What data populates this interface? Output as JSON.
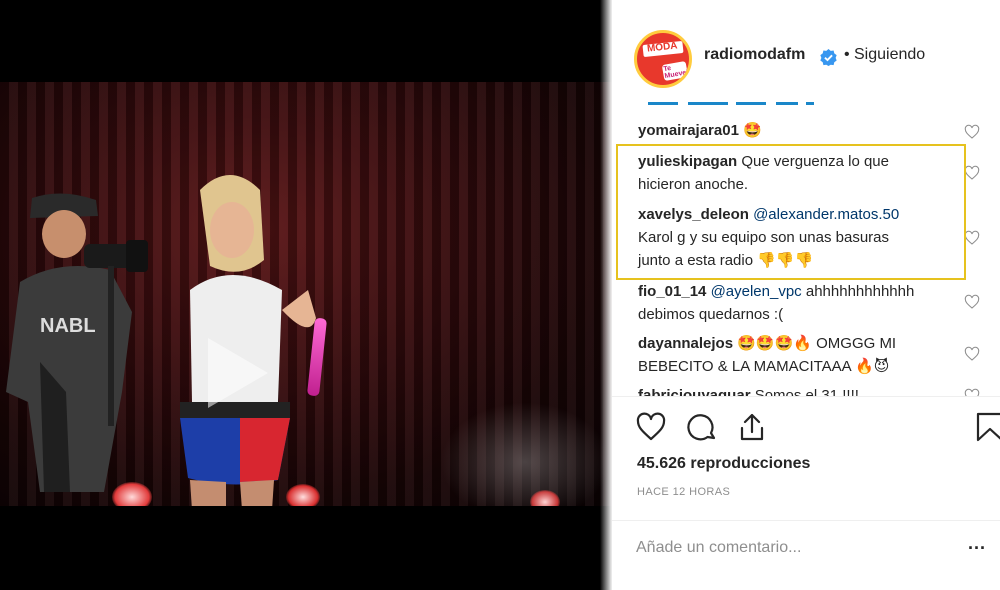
{
  "header": {
    "username": "radiomodafm",
    "separator": "•",
    "follow_status": "Siguiendo",
    "avatar_text_top": "MODA",
    "avatar_text_bottom": "Te Mueve!"
  },
  "comments": [
    {
      "user": "yomairajara01",
      "mention": "",
      "text": "",
      "emoji": "🤩"
    },
    {
      "user": "yulieskipagan",
      "mention": "",
      "text": "Que verguenza lo que",
      "text2": "hicieron anoche."
    },
    {
      "user": "xavelys_deleon",
      "mention": "@alexander.matos.50",
      "text": "Karol g y su equipo son unas basuras",
      "text2": "junto a esta radio",
      "emoji": "👎👎👎"
    },
    {
      "user": "fio_01_14",
      "mention": "@ayelen_vpc",
      "text": "ahhhhhhhhhhhh",
      "text2": "debimos quedarnos :("
    },
    {
      "user": "dayannalejos",
      "emoji": "🤩🤩🤩🔥",
      "text": "OMGGG MI",
      "text2": "BEBECITO & LA MAMACITAAA",
      "emoji2": "🔥😈"
    },
    {
      "user": "fabriciouyaguar",
      "text": "Somos el 31 !!!!"
    }
  ],
  "stats": {
    "views": "45.626 reproducciones",
    "time_ago": "HACE 12 HORAS"
  },
  "add_comment": {
    "placeholder": "Añade un comentario...",
    "more": "..."
  },
  "icons": {
    "like": "heart-icon",
    "comment": "comment-icon",
    "share": "share-icon",
    "save": "bookmark-icon",
    "play": "play-icon",
    "verified": "verified-badge-icon"
  },
  "colors": {
    "highlight": "#e6c21e",
    "verified": "#3897f0",
    "mention": "#00376b"
  }
}
